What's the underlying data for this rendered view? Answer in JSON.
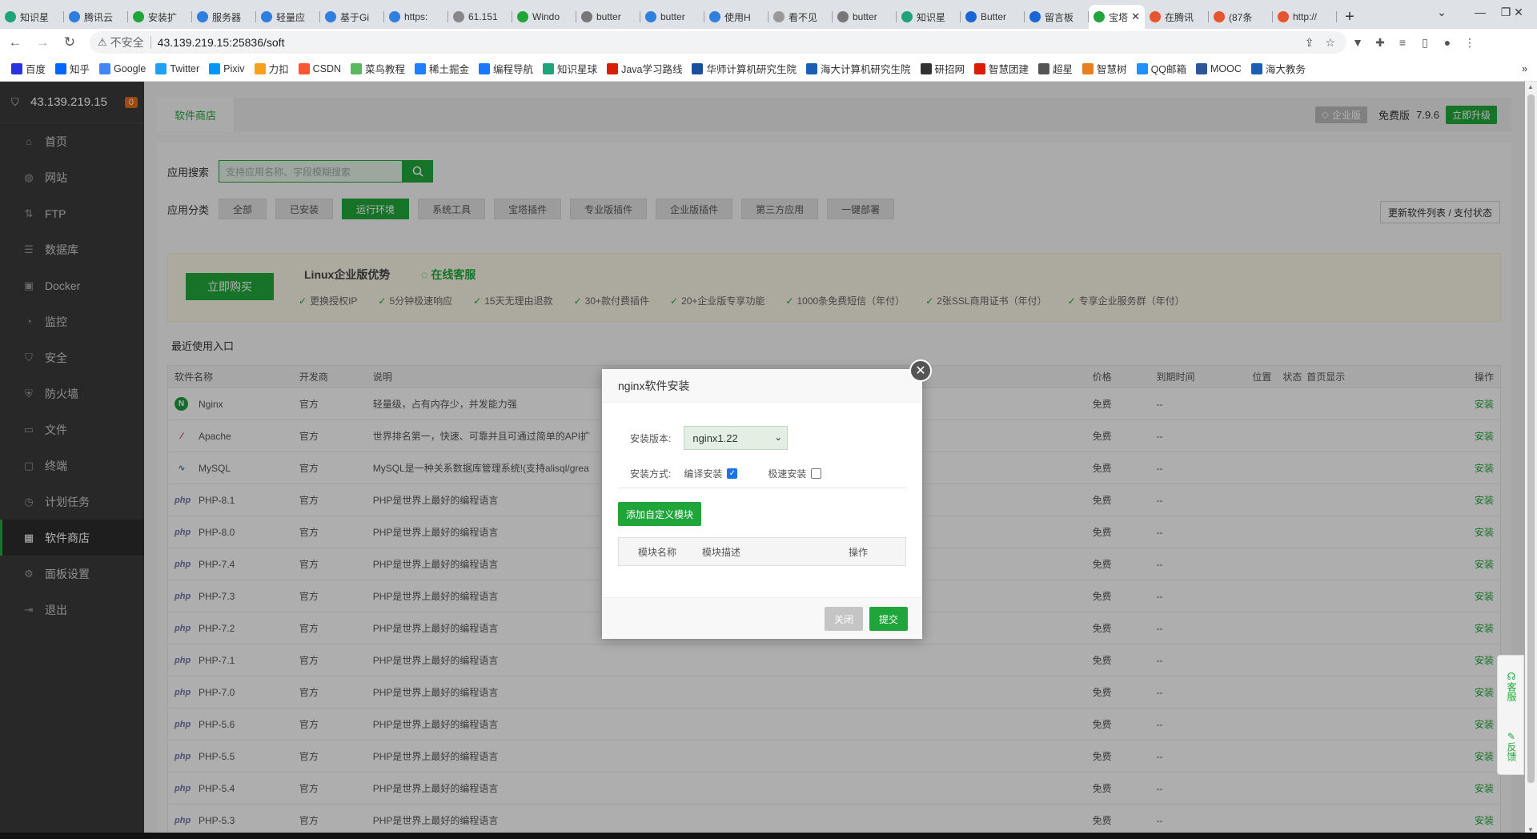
{
  "browser": {
    "tabs": [
      {
        "title": "知识星",
        "color": "#1fa37a"
      },
      {
        "title": "腾讯云",
        "color": "#2f7fe0"
      },
      {
        "title": "安装扩",
        "color": "#20a53a"
      },
      {
        "title": "服务器",
        "color": "#2f7fe0"
      },
      {
        "title": "轻量应",
        "color": "#2f7fe0"
      },
      {
        "title": "基于Gi",
        "color": "#2f7fe0"
      },
      {
        "title": "https:",
        "color": "#2f7fe0"
      },
      {
        "title": "61.151",
        "color": "#888888"
      },
      {
        "title": "Windo",
        "color": "#20a53a"
      },
      {
        "title": "butter",
        "color": "#777777"
      },
      {
        "title": "butter",
        "color": "#2f7fe0"
      },
      {
        "title": "使用H",
        "color": "#2f7fe0"
      },
      {
        "title": "看不见",
        "color": "#999999"
      },
      {
        "title": "butter",
        "color": "#777777"
      },
      {
        "title": "知识星",
        "color": "#1fa37a"
      },
      {
        "title": "Butter",
        "color": "#1967d2"
      },
      {
        "title": "留言板",
        "color": "#1967d2"
      },
      {
        "title": "宝塔",
        "color": "#20a53a",
        "active": true
      },
      {
        "title": "在腾讯",
        "color": "#e8542f"
      },
      {
        "title": "(87条",
        "color": "#e8542f"
      },
      {
        "title": "http://",
        "color": "#e8542f"
      }
    ],
    "insecure_label": "不安全",
    "url": "43.139.219.15:25836/soft",
    "bookmarks": [
      "百度",
      "知乎",
      "Google",
      "Twitter",
      "Pixiv",
      "力扣",
      "CSDN",
      "菜鸟教程",
      "稀土掘金",
      "编程导航",
      "知识星球",
      "Java学习路线",
      "华师计算机研究生院",
      "海大计算机研究生院",
      "研招网",
      "智慧团建",
      "超星",
      "智慧树",
      "QQ邮箱",
      "MOOC",
      "海大教务"
    ]
  },
  "sidebar": {
    "server_ip": "43.139.219.15",
    "badge": "0",
    "items": [
      {
        "label": "首页",
        "icon": "home-icon",
        "glyph": "⌂"
      },
      {
        "label": "网站",
        "icon": "globe-icon",
        "glyph": "◍"
      },
      {
        "label": "FTP",
        "icon": "ftp-icon",
        "glyph": "⇅"
      },
      {
        "label": "数据库",
        "icon": "database-icon",
        "glyph": "☰"
      },
      {
        "label": "Docker",
        "icon": "docker-icon",
        "glyph": "▣"
      },
      {
        "label": "监控",
        "icon": "monitor-icon",
        "glyph": "◔"
      },
      {
        "label": "安全",
        "icon": "shield-icon",
        "glyph": "⛉"
      },
      {
        "label": "防火墙",
        "icon": "firewall-icon",
        "glyph": "⛨"
      },
      {
        "label": "文件",
        "icon": "folder-icon",
        "glyph": "▭"
      },
      {
        "label": "终端",
        "icon": "terminal-icon",
        "glyph": "▢"
      },
      {
        "label": "计划任务",
        "icon": "clock-icon",
        "glyph": "◷"
      },
      {
        "label": "软件商店",
        "icon": "grid-icon",
        "glyph": "▦",
        "active": true
      },
      {
        "label": "面板设置",
        "icon": "gear-icon",
        "glyph": "⚙"
      },
      {
        "label": "退出",
        "icon": "logout-icon",
        "glyph": "⇥"
      }
    ]
  },
  "header": {
    "store_tab": "软件商店",
    "enterprise": "企业版",
    "free_label": "免费版",
    "version": "7.9.6",
    "upgrade": "立即升级"
  },
  "search": {
    "label": "应用搜索",
    "placeholder": "支持应用名称、字段模糊搜索"
  },
  "categories": {
    "label": "应用分类",
    "items": [
      "全部",
      "已安装",
      "运行环境",
      "系统工具",
      "宝塔插件",
      "专业版插件",
      "企业版插件",
      "第三方应用",
      "一键部署"
    ],
    "active_index": 2,
    "refresh": "更新软件列表 / 支付状态"
  },
  "promo": {
    "buy": "立即购买",
    "title": "Linux企业版优势",
    "service": "在线客服",
    "features": [
      "更换授权IP",
      "5分钟极速响应",
      "15天无理由退款",
      "30+款付费插件",
      "20+企业版专享功能",
      "1000条免费短信（年付）",
      "2张SSL商用证书（年付）",
      "专享企业服务群（年付）"
    ]
  },
  "recent_label": "最近使用入口",
  "table": {
    "headers": {
      "name": "软件名称",
      "dev": "开发商",
      "desc": "说明",
      "price": "价格",
      "expire": "到期时间",
      "pos": "位置",
      "status": "状态",
      "home": "首页显示",
      "op": "操作"
    },
    "rows": [
      {
        "icon": "nginx",
        "name": "Nginx",
        "dev": "官方",
        "desc": "轻量级，占有内存少，并发能力强",
        "price": "免费",
        "expire": "--",
        "op": "安装"
      },
      {
        "icon": "apache",
        "name": "Apache",
        "dev": "官方",
        "desc": "世界排名第一，快速、可靠并且可通过简单的API扩",
        "price": "免费",
        "expire": "--",
        "op": "安装"
      },
      {
        "icon": "mysql",
        "name": "MySQL",
        "dev": "官方",
        "desc": "MySQL是一种关系数据库管理系统!(支持alisql/grea",
        "price": "免费",
        "expire": "--",
        "op": "安装"
      },
      {
        "icon": "php",
        "name": "PHP-8.1",
        "dev": "官方",
        "desc": "PHP是世界上最好的编程语言",
        "price": "免费",
        "expire": "--",
        "op": "安装"
      },
      {
        "icon": "php",
        "name": "PHP-8.0",
        "dev": "官方",
        "desc": "PHP是世界上最好的编程语言",
        "price": "免费",
        "expire": "--",
        "op": "安装"
      },
      {
        "icon": "php",
        "name": "PHP-7.4",
        "dev": "官方",
        "desc": "PHP是世界上最好的编程语言",
        "price": "免费",
        "expire": "--",
        "op": "安装"
      },
      {
        "icon": "php",
        "name": "PHP-7.3",
        "dev": "官方",
        "desc": "PHP是世界上最好的编程语言",
        "price": "免费",
        "expire": "--",
        "op": "安装"
      },
      {
        "icon": "php",
        "name": "PHP-7.2",
        "dev": "官方",
        "desc": "PHP是世界上最好的编程语言",
        "price": "免费",
        "expire": "--",
        "op": "安装"
      },
      {
        "icon": "php",
        "name": "PHP-7.1",
        "dev": "官方",
        "desc": "PHP是世界上最好的编程语言",
        "price": "免费",
        "expire": "--",
        "op": "安装"
      },
      {
        "icon": "php",
        "name": "PHP-7.0",
        "dev": "官方",
        "desc": "PHP是世界上最好的编程语言",
        "price": "免费",
        "expire": "--",
        "op": "安装"
      },
      {
        "icon": "php",
        "name": "PHP-5.6",
        "dev": "官方",
        "desc": "PHP是世界上最好的编程语言",
        "price": "免费",
        "expire": "--",
        "op": "安装"
      },
      {
        "icon": "php",
        "name": "PHP-5.5",
        "dev": "官方",
        "desc": "PHP是世界上最好的编程语言",
        "price": "免费",
        "expire": "--",
        "op": "安装"
      },
      {
        "icon": "php",
        "name": "PHP-5.4",
        "dev": "官方",
        "desc": "PHP是世界上最好的编程语言",
        "price": "免费",
        "expire": "--",
        "op": "安装"
      },
      {
        "icon": "php",
        "name": "PHP-5.3",
        "dev": "官方",
        "desc": "PHP是世界上最好的编程语言",
        "price": "免费",
        "expire": "--",
        "op": "安装"
      }
    ]
  },
  "modal": {
    "title": "nginx软件安装",
    "version_label": "安装版本:",
    "version_value": "nginx1.22",
    "method_label": "安装方式:",
    "compile_label": "编译安装",
    "compile_checked": true,
    "fast_label": "极速安装",
    "fast_checked": false,
    "add_module": "添加自定义模块",
    "col_name": "模块名称",
    "col_desc": "模块描述",
    "col_op": "操作",
    "cancel": "关闭",
    "submit": "提交"
  },
  "floatbar": {
    "service": "客服",
    "feedback": "反馈"
  },
  "colors": {
    "accent": "#20a53a",
    "sidebar": "#3a3a3a"
  }
}
